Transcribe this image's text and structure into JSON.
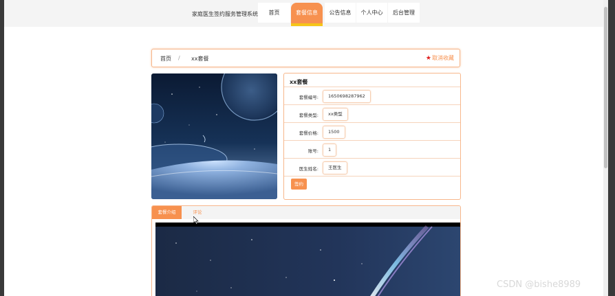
{
  "header": {
    "site_title": "家庭医生签约服务管理系统",
    "nav": [
      {
        "label": "首页",
        "active": false
      },
      {
        "label": "套餐信息",
        "active": true
      },
      {
        "label": "公告信息",
        "active": false
      },
      {
        "label": "个人中心",
        "active": false
      },
      {
        "label": "后台管理",
        "active": false
      }
    ]
  },
  "breadcrumb": {
    "home": "首页",
    "separator": "/",
    "current": "xx套餐",
    "favorite_label": "取消收藏"
  },
  "package": {
    "title": "xx套餐",
    "fields": [
      {
        "label": "套餐编号:",
        "value": "1650698287962"
      },
      {
        "label": "套餐类型:",
        "value": "xx类型"
      },
      {
        "label": "套餐价格:",
        "value": "1500"
      },
      {
        "label": "账号:",
        "value": "1"
      },
      {
        "label": "医生姓名:",
        "value": "王医生"
      }
    ],
    "sign_button": "签约"
  },
  "tabs": [
    {
      "label": "套餐介绍",
      "active": true
    },
    {
      "label": "评论",
      "active": false
    }
  ],
  "watermark": "CSDN @bishe8989",
  "colors": {
    "accent": "#f7914f",
    "accent_border": "#f7b68a",
    "underline": "#f5c518"
  }
}
